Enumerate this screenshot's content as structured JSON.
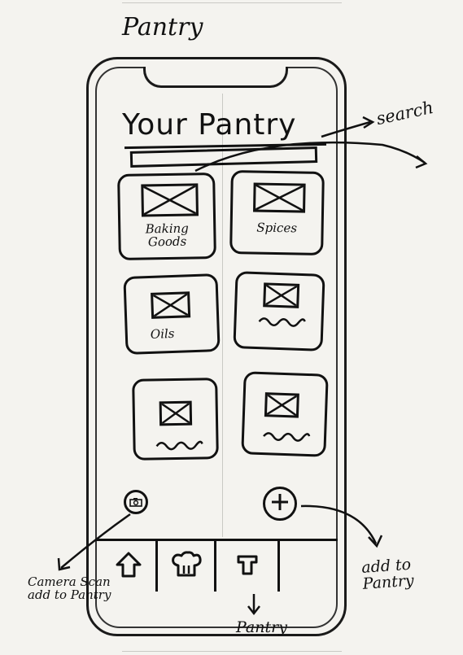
{
  "page": {
    "title": "Pantry"
  },
  "screen": {
    "header_title": "Your Pantry",
    "categories": [
      {
        "label": "Baking Goods",
        "icon": "image-placeholder-icon"
      },
      {
        "label": "Spices",
        "icon": "image-placeholder-icon"
      },
      {
        "label": "Oils",
        "icon": "image-placeholder-icon"
      },
      {
        "label": "",
        "icon": "image-placeholder-icon"
      },
      {
        "label": "",
        "icon": "image-placeholder-icon"
      },
      {
        "label": "",
        "icon": "image-placeholder-icon"
      }
    ],
    "camera_button_icon": "camera-icon",
    "add_button_icon": "plus-icon",
    "tabs": [
      {
        "icon": "home-icon"
      },
      {
        "icon": "chef-hat-icon"
      },
      {
        "icon": "pantry-icon"
      },
      {
        "icon": ""
      }
    ]
  },
  "annotations": {
    "search": "search",
    "camera": "Camera Scan add to Pantry",
    "add": "add to Pantry",
    "pantry_tab": "Pantry"
  }
}
